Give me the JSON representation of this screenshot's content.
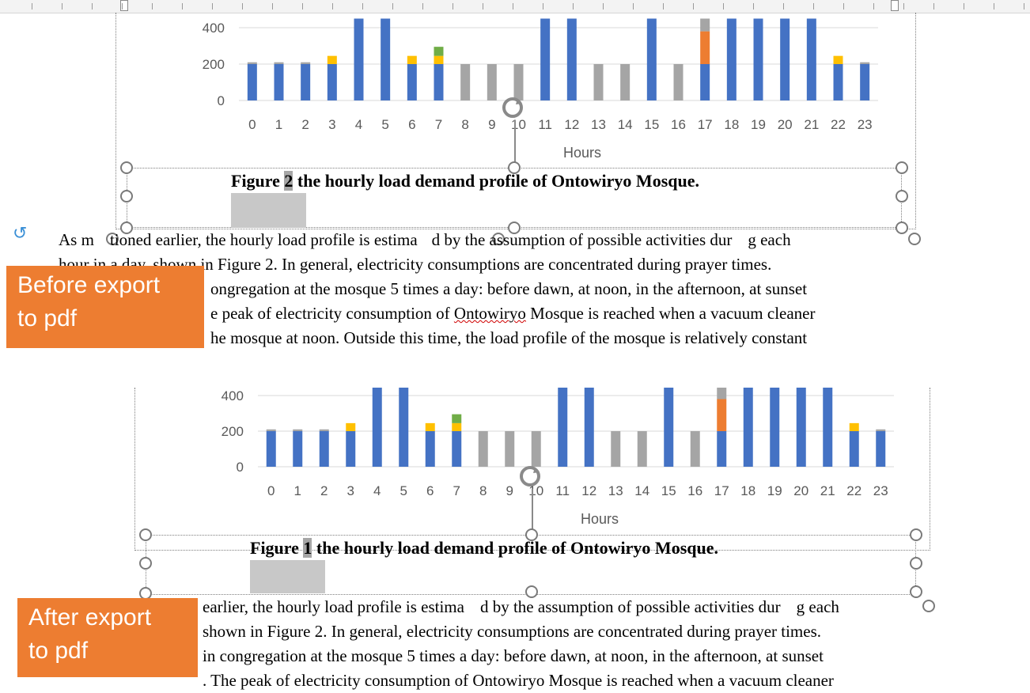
{
  "panels": [
    {
      "label": "Before export\nto pdf",
      "caption_prefix": "Figure ",
      "caption_number": "2",
      "caption_rest": " the hourly load demand profile of Ontowiryo Mosque.",
      "paragraph": [
        "As m",
        "tioned earlier, the hourly load profile is estima",
        "d by the assumption of possible activities dur",
        "g each",
        "hour in a day, shown in Figure 2. In general, electricity consumptions are concentrated during prayer times.",
        "ongregation at the mosque 5 times a day: before dawn, at noon, in the afternoon, at sunset",
        "e peak of electricity consumption of ",
        "Ontowiryo",
        " Mosque is reached when a vacuum cleaner",
        "he mosque at noon. Outside this time, the load profile of the mosque is relatively constant"
      ]
    },
    {
      "label": "After export\nto pdf",
      "caption_prefix": "Figure ",
      "caption_number": "1",
      "caption_rest": " the hourly load demand profile of Ontowiryo Mosque.",
      "paragraph": [
        "earlier, the hourly load profile is estima",
        "d by the assumption of possible activities dur",
        "g each",
        "shown in Figure 2. In general, electricity consumptions are concentrated during prayer times.",
        "in congregation at the mosque 5 times a day: before dawn, at noon, in the afternoon, at sunset",
        ". The peak of electricity consumption of Ontowiryo Mosque is reached when a vacuum cleaner"
      ]
    }
  ],
  "colors": {
    "blue": "#4472c4",
    "gray": "#a5a5a5",
    "yellow": "#ffc000",
    "green": "#70ad47",
    "orange": "#ed7d31",
    "badge": "#ed7d31"
  },
  "chart_data": {
    "type": "bar",
    "stacked": true,
    "categories": [
      "0",
      "1",
      "2",
      "3",
      "4",
      "5",
      "6",
      "7",
      "8",
      "9",
      "10",
      "11",
      "12",
      "13",
      "14",
      "15",
      "16",
      "17",
      "18",
      "19",
      "20",
      "21",
      "22",
      "23"
    ],
    "xlabel": "Hours",
    "ylabel": "",
    "yticks": [
      0,
      200,
      400
    ],
    "ylim": [
      0,
      450
    ],
    "series": [
      {
        "color": "blue",
        "values": [
          200,
          200,
          200,
          200,
          450,
          450,
          200,
          200,
          0,
          0,
          0,
          450,
          450,
          0,
          0,
          450,
          0,
          200,
          450,
          450,
          450,
          450,
          200,
          200
        ]
      },
      {
        "color": "gray",
        "values": [
          10,
          10,
          10,
          0,
          0,
          0,
          0,
          0,
          200,
          200,
          200,
          0,
          0,
          200,
          200,
          0,
          200,
          0,
          0,
          0,
          0,
          0,
          0,
          10
        ]
      },
      {
        "color": "yellow",
        "values": [
          0,
          0,
          0,
          45,
          0,
          0,
          45,
          45,
          0,
          0,
          0,
          0,
          0,
          0,
          0,
          0,
          0,
          0,
          0,
          0,
          0,
          0,
          45,
          0
        ]
      },
      {
        "color": "green",
        "values": [
          0,
          0,
          0,
          0,
          0,
          0,
          0,
          50,
          0,
          0,
          0,
          0,
          0,
          0,
          0,
          0,
          0,
          0,
          0,
          0,
          0,
          0,
          0,
          0
        ]
      },
      {
        "color": "orange",
        "values": [
          0,
          0,
          0,
          0,
          0,
          0,
          0,
          0,
          0,
          0,
          0,
          0,
          0,
          0,
          0,
          0,
          0,
          180,
          0,
          0,
          0,
          0,
          0,
          0
        ]
      },
      {
        "color": "gray",
        "values": [
          0,
          0,
          0,
          0,
          0,
          0,
          0,
          0,
          0,
          0,
          0,
          0,
          0,
          0,
          0,
          0,
          0,
          70,
          0,
          0,
          0,
          0,
          0,
          0
        ]
      }
    ]
  }
}
